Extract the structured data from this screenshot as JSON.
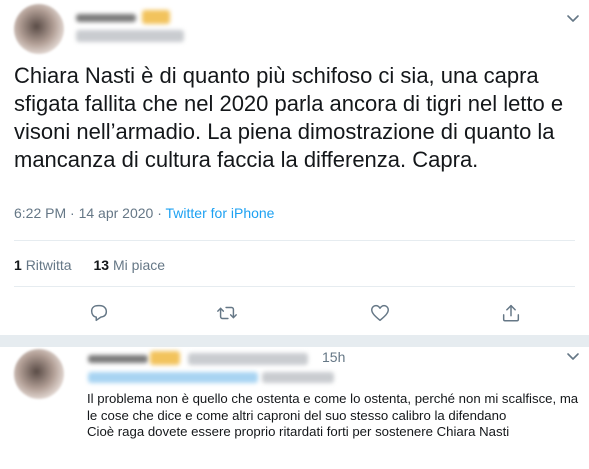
{
  "tweet": {
    "text": "Chiara Nasti è di quanto più schifoso ci sia, una capra sfigata fallita che nel 2020 parla ancora di tigri nel letto e visoni nell’armadio. La piena dimostrazione di quanto la mancanza di cultura faccia la differenza. Capra.",
    "time": "6:22 PM",
    "dot": "·",
    "date": "14 apr 2020",
    "source": "Twitter for iPhone",
    "retweets_count": "1",
    "retweets_label": "Ritwitta",
    "likes_count": "13",
    "likes_label": "Mi piace"
  },
  "reply": {
    "time": "15h",
    "lines": [
      "Il problema non è quello che ostenta e come lo ostenta, perché non mi scalfisce, ma le cose che dice e come altri caproni del suo stesso calibro la difendano",
      "Cioè raga dovete essere proprio ritardati forti per sostenere Chiara Nasti"
    ]
  },
  "icons": {
    "caret": "chevron-down-icon",
    "reply": "reply-icon",
    "retweet": "retweet-icon",
    "like": "heart-icon",
    "share": "share-icon"
  },
  "colors": {
    "text": "#14171a",
    "secondary": "#657786",
    "link": "#1da1f2",
    "border": "#e6ecf0"
  }
}
